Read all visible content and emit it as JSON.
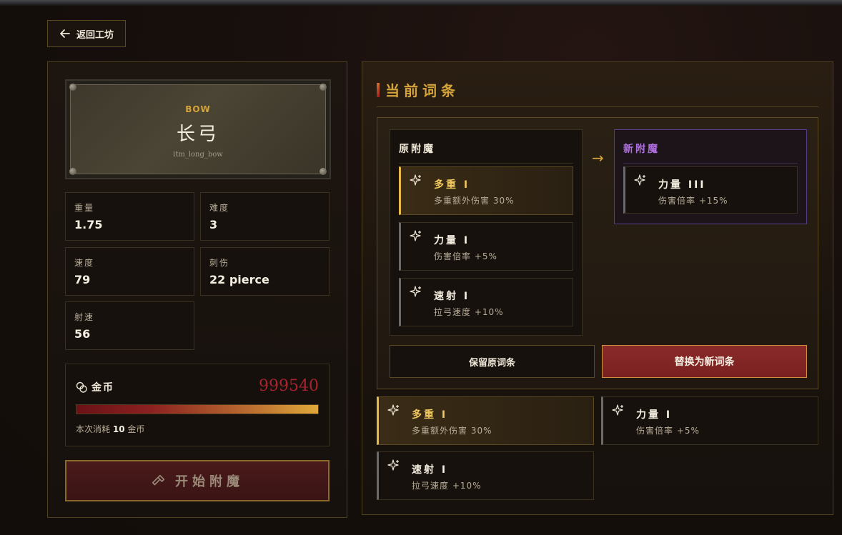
{
  "nav": {
    "back_label": "返回工坊"
  },
  "item": {
    "category": "BOW",
    "name": "长弓",
    "id": "itm_long_bow"
  },
  "stats": [
    {
      "label": "重量",
      "value": "1.75"
    },
    {
      "label": "难度",
      "value": "3"
    },
    {
      "label": "速度",
      "value": "79"
    },
    {
      "label": "刺伤",
      "value": "22 pierce"
    },
    {
      "label": "射速",
      "value": "56"
    }
  ],
  "gold": {
    "label": "金币",
    "amount": "999540",
    "cost_prefix": "本次消耗",
    "cost_value": "10",
    "cost_suffix": "金币",
    "bar_fill_fraction": 1.0
  },
  "start_button": {
    "label": "开始附魔"
  },
  "current": {
    "title": "当前词条",
    "old_heading": "原附魔",
    "new_heading": "新附魔",
    "old_list": [
      {
        "name": "多重 I",
        "desc": "多重额外伤害 30%",
        "selected": true
      },
      {
        "name": "力量 I",
        "desc": "伤害倍率 +5%",
        "selected": false
      },
      {
        "name": "速射 I",
        "desc": "拉弓速度 +10%",
        "selected": false
      }
    ],
    "new_list": [
      {
        "name": "力量 III",
        "desc": "伤害倍率 +15%"
      }
    ],
    "keep_label": "保留原词条",
    "replace_label": "替换为新词条"
  },
  "affixes": [
    {
      "name": "多重 I",
      "desc": "多重额外伤害 30%",
      "selected": true
    },
    {
      "name": "力量 I",
      "desc": "伤害倍率 +5%",
      "selected": false
    },
    {
      "name": "速射 I",
      "desc": "拉弓速度 +10%",
      "selected": false
    }
  ],
  "colors": {
    "accent_gold": "#d4a43a",
    "danger_red": "#a8242c",
    "new_purple": "#b070e0"
  },
  "icons": {
    "back": "arrow-left-icon",
    "gold": "coins-icon",
    "enchant": "sparkle-icon",
    "start": "hammer-icon",
    "compare": "arrow-right-icon"
  }
}
